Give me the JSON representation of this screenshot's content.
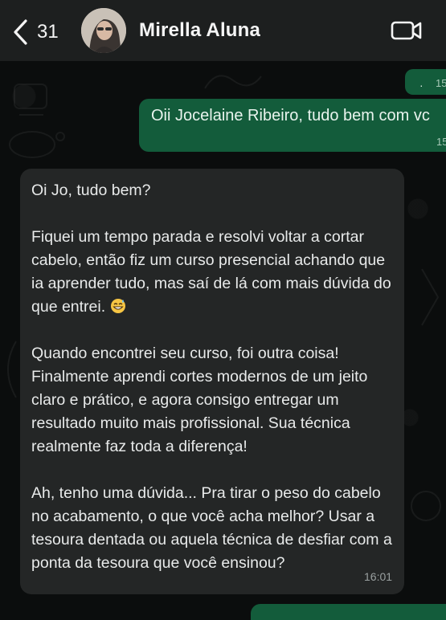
{
  "header": {
    "back_count": "31",
    "contact_name": "Mirella Aluna",
    "icons": {
      "back": "chevron-left-icon",
      "video": "video-camera-icon"
    }
  },
  "messages": {
    "outgoing_1": {
      "dot": "·",
      "time": "15"
    },
    "outgoing_2": {
      "text": "Oii Jocelaine Ribeiro, tudo bem com vc",
      "time": "15"
    },
    "incoming_1": {
      "paragraphs": [
        "Oi Jo, tudo bem?",
        "Fiquei um tempo parada e resolvi voltar a cortar cabelo, então fiz um curso presencial achando que ia aprender tudo, mas saí de lá com mais dúvida do que entrei.",
        "Quando encontrei seu curso, foi outra coisa! Finalmente aprendi cortes modernos de um jeito claro e prático, e agora consigo entregar um resultado muito mais profissional. Sua técnica realmente faz toda a diferença!",
        "Ah, tenho uma dúvida... Pra tirar o peso do cabelo no acabamento, o que você acha melhor? Usar a tesoura dentada ou aquela técnica de desfiar com a ponta da tesoura que você ensinou?"
      ],
      "emoji": "grinning-sweat-emoji",
      "time": "16:01"
    }
  },
  "colors": {
    "header_bg": "#1d1f1f",
    "chat_bg": "#0b0d0d",
    "outgoing_bubble": "#135c3b",
    "incoming_bubble": "#242626",
    "text_primary": "#e8eaea"
  }
}
